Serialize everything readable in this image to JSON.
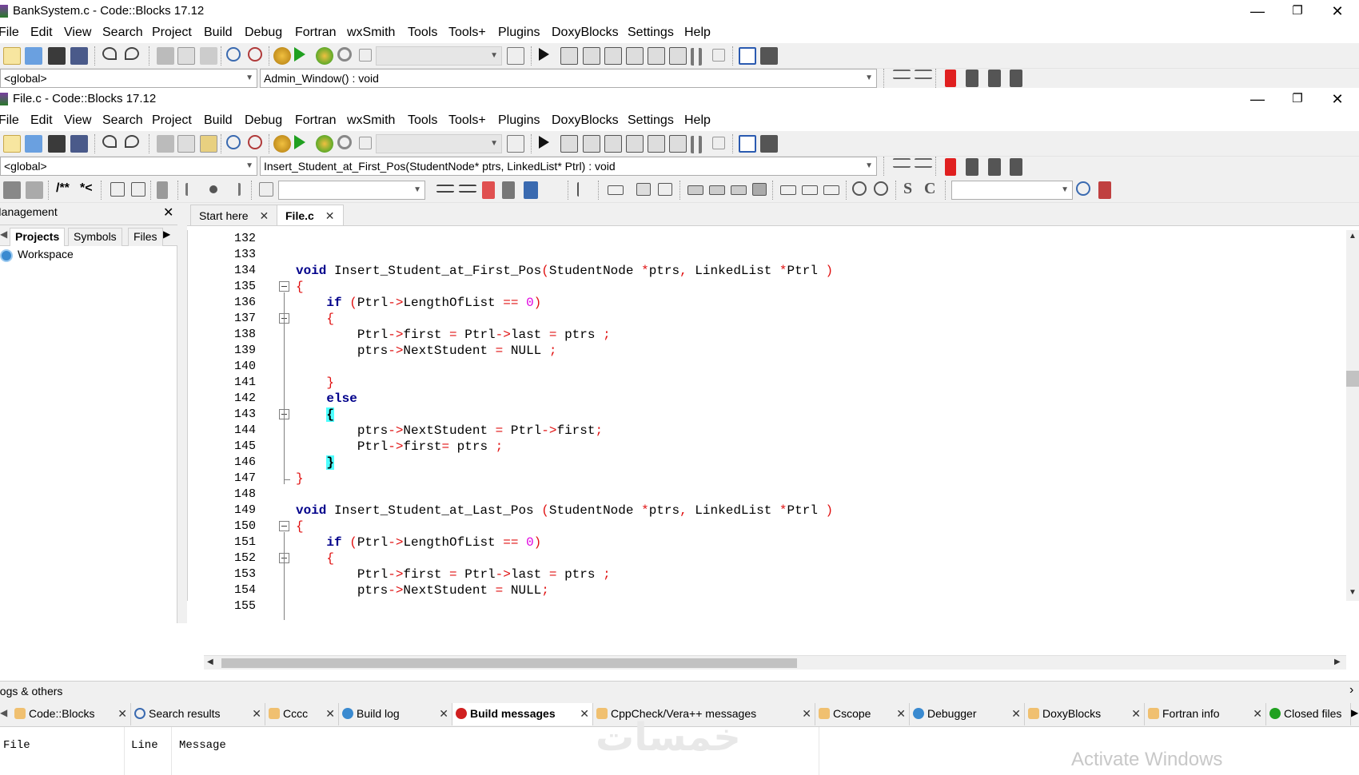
{
  "window1": {
    "title": "BankSystem.c - Code::Blocks 17.12",
    "controls": {
      "minimize": "—",
      "maximize": "❐",
      "close": "✕"
    },
    "menu": [
      "File",
      "Edit",
      "View",
      "Search",
      "Project",
      "Build",
      "Debug",
      "Fortran",
      "wxSmith",
      "Tools",
      "Tools+",
      "Plugins",
      "DoxyBlocks",
      "Settings",
      "Help"
    ],
    "scope_combo": "<global>",
    "function_combo": "Admin_Window() : void"
  },
  "window2": {
    "title": "File.c - Code::Blocks 17.12",
    "controls": {
      "minimize": "—",
      "maximize": "❐",
      "close": "✕"
    },
    "menu": [
      "File",
      "Edit",
      "View",
      "Search",
      "Project",
      "Build",
      "Debug",
      "Fortran",
      "wxSmith",
      "Tools",
      "Tools+",
      "Plugins",
      "DoxyBlocks",
      "Settings",
      "Help"
    ],
    "scope_combo": "<global>",
    "function_combo": "Insert_Student_at_First_Pos(StudentNode* ptrs, LinkedList* Ptrl) : void",
    "toolbar3_text": {
      "doxy_comment": "/**",
      "doxy_line": "*<",
      "s_letter": "S",
      "c_letter": "C"
    }
  },
  "management": {
    "header": "Management",
    "close": "✕",
    "tabs": [
      "Projects",
      "Symbols",
      "Files"
    ],
    "active_tab": "Projects",
    "tree": [
      {
        "label": "Workspace"
      }
    ]
  },
  "editor": {
    "tabs": [
      {
        "label": "Start here",
        "close": "✕"
      },
      {
        "label": "File.c",
        "close": "✕"
      }
    ],
    "active_tab": "File.c",
    "line_numbers": [
      "132",
      "133",
      "134",
      "135",
      "136",
      "137",
      "138",
      "139",
      "140",
      "141",
      "142",
      "143",
      "144",
      "145",
      "146",
      "147",
      "148",
      "149",
      "150",
      "151",
      "152",
      "153",
      "154",
      "155"
    ],
    "code": {
      "l134": {
        "kw": "void",
        "name": " Insert_Student_at_First_Pos",
        "p1": "(",
        "t1": "StudentNode ",
        "s1": "*",
        "v1": "ptrs",
        "c1": ",",
        "t2": " LinkedList ",
        "s2": "*",
        "v2": "Ptrl",
        "p2": " )"
      },
      "l135": "{",
      "l136": {
        "kw": "if",
        "sp": " ",
        "p1": "(",
        "a": "Ptrl",
        "arrow": "->",
        "b": "LengthOfList",
        "eq": " == ",
        "n": "0",
        "p2": ")"
      },
      "l137": "{",
      "l138": {
        "a": "Ptrl",
        "arrow1": "->",
        "b": "first",
        "eq1": " = ",
        "c": "Ptrl",
        "arrow2": "->",
        "d": "last",
        "eq2": " = ",
        "e": "ptrs",
        "semi": " ;"
      },
      "l139": {
        "a": "ptrs",
        "arrow": "->",
        "b": "NextStudent",
        "eq": " = ",
        "c": "NULL",
        "semi": " ;"
      },
      "l141": "}",
      "l142": "else",
      "l143": "{",
      "l144": {
        "a": "ptrs",
        "arrow1": "->",
        "b": "NextStudent",
        "eq": " = ",
        "c": "Ptrl",
        "arrow2": "->",
        "d": "first",
        "semi": ";"
      },
      "l145": {
        "a": "Ptrl",
        "arrow": "->",
        "b": "first",
        "eq": "= ",
        "c": "ptrs",
        "semi": " ;"
      },
      "l146": "}",
      "l147": "}",
      "l149": {
        "kw": "void",
        "name": " Insert_Student_at_Last_Pos ",
        "p1": "(",
        "t1": "StudentNode ",
        "s1": "*",
        "v1": "ptrs",
        "c1": ",",
        "t2": " LinkedList ",
        "s2": "*",
        "v2": "Ptrl",
        "p2": " )"
      },
      "l150": "{",
      "l151": {
        "kw": "if",
        "sp": " ",
        "p1": "(",
        "a": "Ptrl",
        "arrow": "->",
        "b": "LengthOfList",
        "eq": " == ",
        "n": "0",
        "p2": ")"
      },
      "l152": "{",
      "l153": {
        "a": "Ptrl",
        "arrow1": "->",
        "b": "first",
        "eq1": " = ",
        "c": "Ptrl",
        "arrow2": "->",
        "d": "last",
        "eq2": " = ",
        "e": "ptrs",
        "semi": " ;"
      },
      "l154": {
        "a": "ptrs",
        "arrow": "->",
        "b": "NextStudent",
        "eq": " = ",
        "c": "NULL",
        "semi": ";"
      }
    }
  },
  "logs": {
    "header": "Logs & others",
    "tabs": [
      {
        "label": "Code::Blocks",
        "icon": "codeblocks-icon"
      },
      {
        "label": "Search results",
        "icon": "search-icon"
      },
      {
        "label": "Cccc",
        "icon": "pencil-icon"
      },
      {
        "label": "Build log",
        "icon": "gear-icon"
      },
      {
        "label": "Build messages",
        "icon": "bug-icon"
      },
      {
        "label": "CppCheck/Vera++ messages",
        "icon": "pencil-icon"
      },
      {
        "label": "Cscope",
        "icon": "pencil-icon"
      },
      {
        "label": "Debugger",
        "icon": "gear-icon"
      },
      {
        "label": "DoxyBlocks",
        "icon": "pencil-icon"
      },
      {
        "label": "Fortran info",
        "icon": "pencil-icon"
      },
      {
        "label": "Closed files",
        "icon": "refresh-icon"
      }
    ],
    "active_tab": "Build messages",
    "columns": [
      "File",
      "Line",
      "Message"
    ]
  },
  "watermarks": {
    "activate": "Activate Windows",
    "site": "خمسات"
  },
  "colors": {
    "keyword": "#00008b",
    "operator": "#e01010",
    "number": "#e000e0",
    "brace_highlight": "#4dffff"
  }
}
